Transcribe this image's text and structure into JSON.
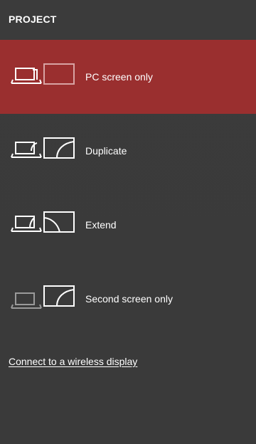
{
  "title": "PROJECT",
  "options": [
    {
      "label": "PC screen only",
      "selected": true,
      "icon": "pc-screen-only-icon"
    },
    {
      "label": "Duplicate",
      "selected": false,
      "icon": "duplicate-icon"
    },
    {
      "label": "Extend",
      "selected": false,
      "icon": "extend-icon"
    },
    {
      "label": "Second screen only",
      "selected": false,
      "icon": "second-screen-only-icon"
    }
  ],
  "link": {
    "label": "Connect to a wireless display"
  },
  "colors": {
    "background": "#3a3a3a",
    "selected": "#9a2f2f",
    "text": "#ffffff",
    "muted_icon": "#9a9a9a",
    "selected_muted_icon": "#d8a3a3"
  }
}
